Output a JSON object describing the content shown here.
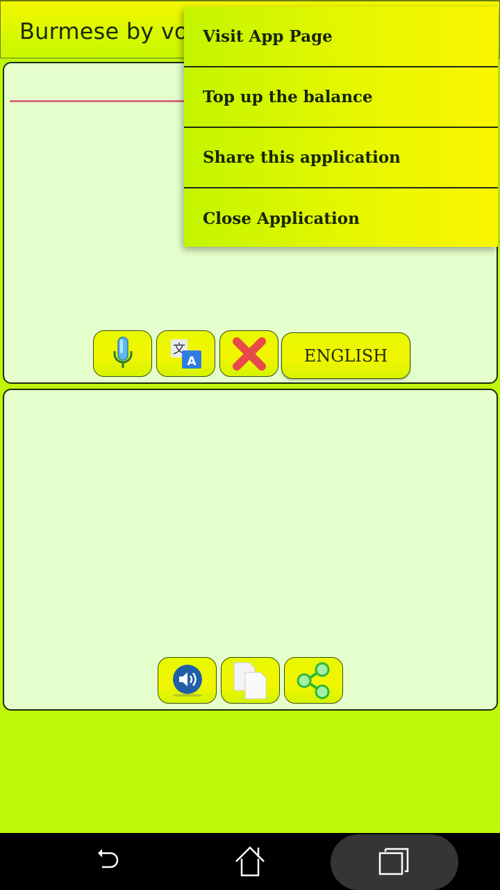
{
  "app_bar": {
    "title": "Burmese by voice"
  },
  "input_panel": {
    "buttons": [
      {
        "name": "microphone",
        "icon": "microphone-icon"
      },
      {
        "name": "translate",
        "icon": "translate-icon"
      },
      {
        "name": "clear",
        "icon": "close-x-icon"
      }
    ],
    "language_button": "ENGLISH"
  },
  "output_panel": {
    "buttons": [
      {
        "name": "speak",
        "icon": "speaker-icon"
      },
      {
        "name": "copy",
        "icon": "copy-icon"
      },
      {
        "name": "share",
        "icon": "share-icon"
      }
    ]
  },
  "overflow_menu": {
    "items": [
      {
        "label": "Visit App Page"
      },
      {
        "label": "Top up the balance"
      },
      {
        "label": "Share this application"
      },
      {
        "label": "Close Application"
      }
    ]
  },
  "nav_bar": {
    "buttons": [
      "back",
      "home",
      "recents"
    ]
  },
  "colors": {
    "background": "#bef70a",
    "panel": "#e5ffcc",
    "accent_line": "#d9697a",
    "menu_start": "#c3f500",
    "menu_end": "#fbf600"
  }
}
